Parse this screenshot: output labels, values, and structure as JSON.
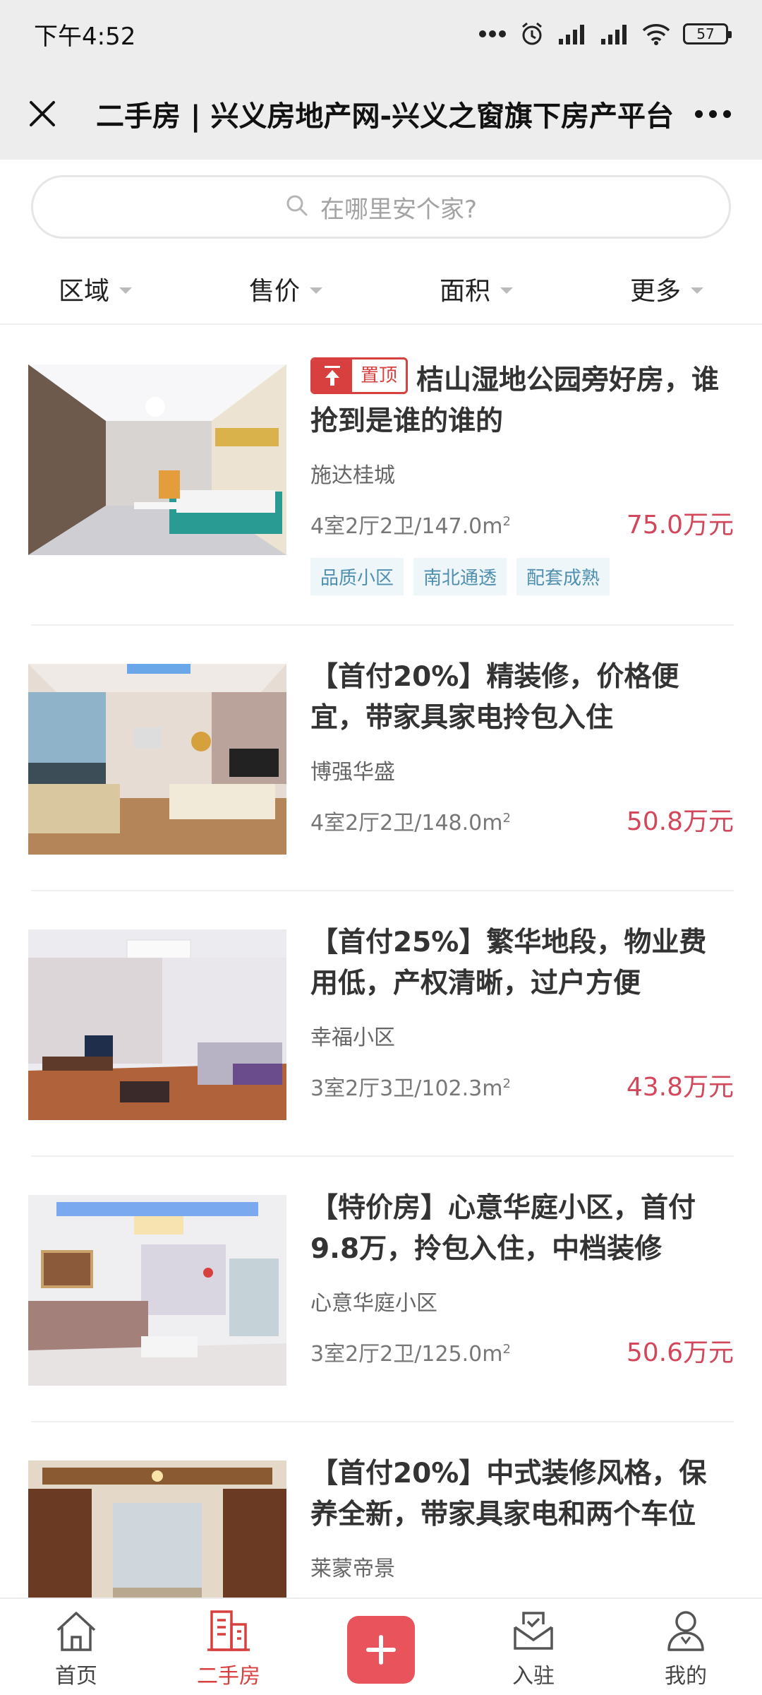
{
  "status_bar": {
    "time": "下午4:52",
    "battery": "57"
  },
  "title_bar": {
    "title": "二手房 | 兴义房地产网-兴义之窗旗下房产平台",
    "close_icon": "close-icon",
    "more_icon": "more-icon"
  },
  "search": {
    "placeholder": "在哪里安个家?"
  },
  "filters": [
    {
      "label": "区域"
    },
    {
      "label": "售价"
    },
    {
      "label": "面积"
    },
    {
      "label": "更多"
    }
  ],
  "listings": [
    {
      "badge": "置顶",
      "title": "桔山湿地公园旁好房，谁抢到是谁的谁的",
      "community": "施达桂城",
      "layout": "4室2厅2卫/147.0m",
      "price": "75.0万元",
      "tags": [
        "品质小区",
        "南北通透",
        "配套成熟"
      ]
    },
    {
      "title": "【首付20%】精装修，价格便宜，带家具家电拎包入住",
      "community": "博强华盛",
      "layout": "4室2厅2卫/148.0m",
      "price": "50.8万元"
    },
    {
      "title": "【首付25%】繁华地段，物业费用低，产权清晰，过户方便",
      "community": "幸福小区",
      "layout": "3室2厅3卫/102.3m",
      "price": "43.8万元"
    },
    {
      "title": "【特价房】心意华庭小区，首付9.8万，拎包入住，中档装修",
      "community": "心意华庭小区",
      "layout": "3室2厅2卫/125.0m",
      "price": "50.6万元"
    },
    {
      "title": "【首付20%】中式装修风格，保养全新，带家具家电和两个车位",
      "community": "莱蒙帝景",
      "layout": "",
      "price": ""
    }
  ],
  "area_unit_sup": "2",
  "bottom_nav": [
    {
      "label": "首页",
      "icon": "home-icon"
    },
    {
      "label": "二手房",
      "icon": "building-icon",
      "active": true
    },
    {
      "label": "",
      "icon": "plus-icon"
    },
    {
      "label": "入驻",
      "icon": "inbox-icon"
    },
    {
      "label": "我的",
      "icon": "user-icon"
    }
  ],
  "colors": {
    "accent": "#d8403f",
    "price": "#d3475a",
    "tag_text": "#4f8fb0",
    "tag_bg": "#eef6f9"
  }
}
